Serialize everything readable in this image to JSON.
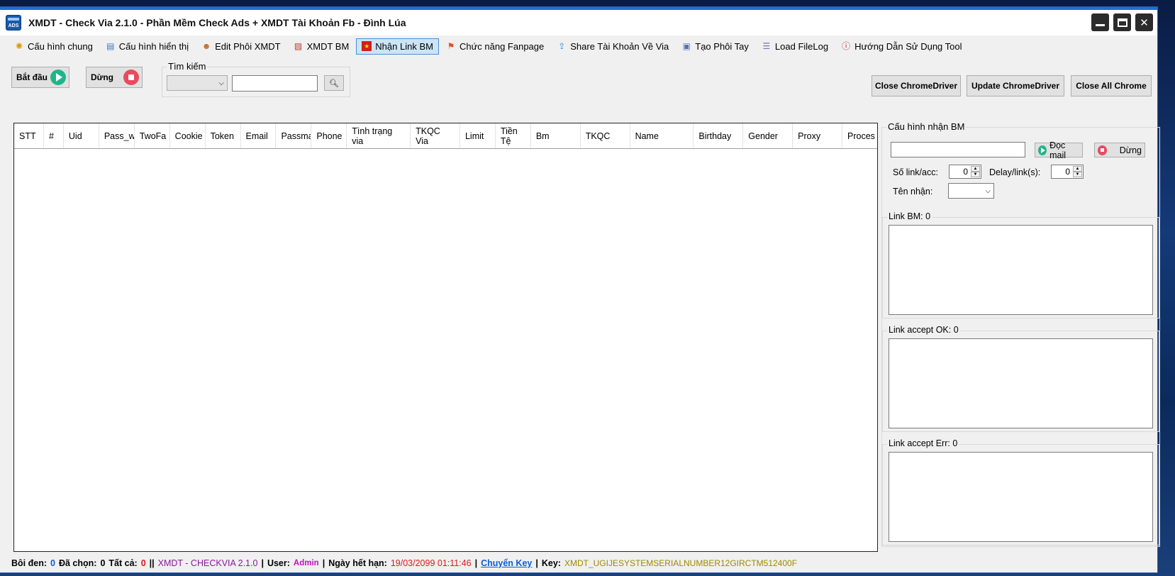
{
  "window": {
    "title": "XMDT - Check Via 2.1.0 - Phần Mềm Check Ads + XMDT Tài Khoản Fb - Đình Lúa",
    "icon_text": "ADS"
  },
  "menu": [
    {
      "label": "Cấu hình chung",
      "icon": "gear-icon"
    },
    {
      "label": "Cấu hình hiển thị",
      "icon": "window-icon"
    },
    {
      "label": "Edit Phôi XMDT",
      "icon": "user-icon"
    },
    {
      "label": "XMDT BM",
      "icon": "doc-x-icon"
    },
    {
      "label": "Nhận Link BM",
      "icon": "flag-vn-icon",
      "active": true
    },
    {
      "label": "Chức năng Fanpage",
      "icon": "flag-icon"
    },
    {
      "label": "Share Tài Khoản Về Via",
      "icon": "share-icon"
    },
    {
      "label": "Tạo Phôi Tay",
      "icon": "id-card-icon"
    },
    {
      "label": "Load FileLog",
      "icon": "log-icon"
    },
    {
      "label": "Hướng Dẫn Sử Dụng Tool",
      "icon": "info-icon"
    }
  ],
  "toolbar": {
    "start_label": "Bắt đầu",
    "stop_label": "Dừng",
    "search_legend": "Tìm kiếm",
    "search_value": "",
    "close_chromedriver": "Close ChromeDriver",
    "update_chromedriver": "Update ChromeDriver",
    "close_all_chrome": "Close All Chrome"
  },
  "grid": {
    "columns": [
      "STT",
      "#",
      "Uid",
      "Pass_w",
      "TwoFa",
      "Cookie",
      "Token",
      "Email",
      "Passmai",
      "Phone",
      "Tình trạng via",
      "TKQC Via",
      "Limit",
      "Tiền Tệ",
      "Bm",
      "TKQC",
      "Name",
      "Birthday",
      "Gender",
      "Proxy",
      "Proces"
    ],
    "rows": []
  },
  "right_panel": {
    "title": "Cấu hình nhận BM",
    "mail_value": "",
    "read_mail_label": "Đọc mail",
    "stop_label": "Dừng",
    "links_per_acc_label": "Số link/acc:",
    "links_per_acc_value": "0",
    "delay_label": "Delay/link(s):",
    "delay_value": "0",
    "receiver_label": "Tên nhận:",
    "receiver_value": "",
    "link_bm_label": "Link BM: 0",
    "link_ok_label": "Link accept OK: 0",
    "link_err_label": "Link accept Err: 0"
  },
  "status": {
    "boi_den_label": "Bôi đen:",
    "boi_den_value": "0",
    "da_chon_label": "Đã chọn:",
    "da_chon_value": "0",
    "tat_ca_label": "Tất cả:",
    "tat_ca_value": "0",
    "app_version": "XMDT - CHECKVIA  2.1.0",
    "user_label": "User:",
    "user_value": "Admin",
    "expiry_label": "Ngày hết hạn:",
    "expiry_value": "19/03/2099 01:11:46",
    "switch_key": "Chuyển Key",
    "key_label": "Key:",
    "key_value": "XMDT_UGIJESYSTEMSERIALNUMBER12GIRCTM512400F"
  }
}
